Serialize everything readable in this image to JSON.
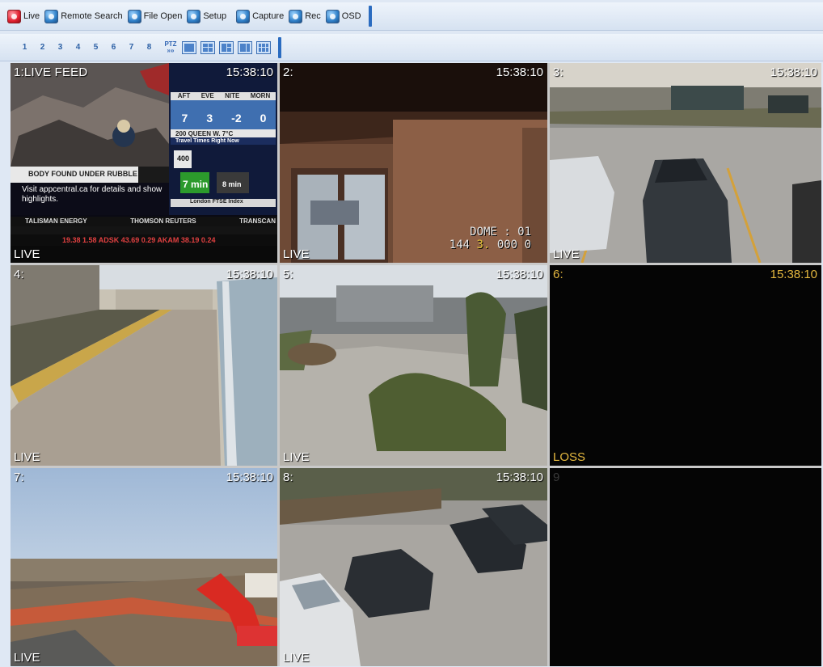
{
  "toolbar": {
    "buttons": [
      {
        "label": "Live",
        "icon": "live-icon"
      },
      {
        "label": "Remote Search",
        "icon": "remote-search-icon"
      },
      {
        "label": "File Open",
        "icon": "file-open-icon"
      },
      {
        "label": "Setup",
        "icon": "setup-icon"
      },
      {
        "label": "Capture",
        "icon": "capture-icon"
      },
      {
        "label": "Rec",
        "icon": "rec-icon"
      },
      {
        "label": "OSD",
        "icon": "osd-icon"
      }
    ]
  },
  "channel_bar": {
    "numbers": [
      "1",
      "2",
      "3",
      "4",
      "5",
      "6",
      "7",
      "8"
    ],
    "ptz_label": "PTZ"
  },
  "cameras": [
    {
      "name": "1:LIVE FEED",
      "time": "15:38:10",
      "status": "LIVE"
    },
    {
      "name": "2:",
      "time": "15:38:10",
      "status": "LIVE",
      "dome": "DOME : 01",
      "dome_values": [
        "144",
        "3",
        "000",
        "0"
      ]
    },
    {
      "name": "3:",
      "time": "15:38:10",
      "status": "LIVE"
    },
    {
      "name": "4:",
      "time": "15:38:10",
      "status": "LIVE"
    },
    {
      "name": "5:",
      "time": "15:38:10",
      "status": "LIVE"
    },
    {
      "name": "6:",
      "time": "15:38:10",
      "status": "LOSS"
    },
    {
      "name": "7:",
      "time": "15:38:10",
      "status": "LIVE"
    },
    {
      "name": "8:",
      "time": "15:38:10",
      "status": "LIVE"
    },
    {
      "name": "9",
      "time": "",
      "status": ""
    }
  ],
  "news": {
    "headline": "BODY FOUND UNDER RUBBLE",
    "promo": "Visit appcentral.ca for details and show highlights.",
    "weather_times": [
      "AFT",
      "EVE",
      "NITE",
      "MORN"
    ],
    "weather_temps": [
      "7",
      "3",
      "-2",
      "0"
    ],
    "address": "200 QUEEN W. 7°C",
    "travel": "Travel Times Right Now",
    "route": "400",
    "travel_time": "7 min",
    "travel_alt": "8 min",
    "index": "London FTSE Index",
    "ticker_top": [
      "TALISMAN ENERGY",
      "THOMSON REUTERS",
      "TRANSCAN"
    ],
    "ticker_bottom": "19.38 1.58  ADSK 43.69 0.29  AKAM 38.19 0.24"
  },
  "colors": {
    "accent": "#2b6cc0",
    "loss": "#e5b83f"
  }
}
